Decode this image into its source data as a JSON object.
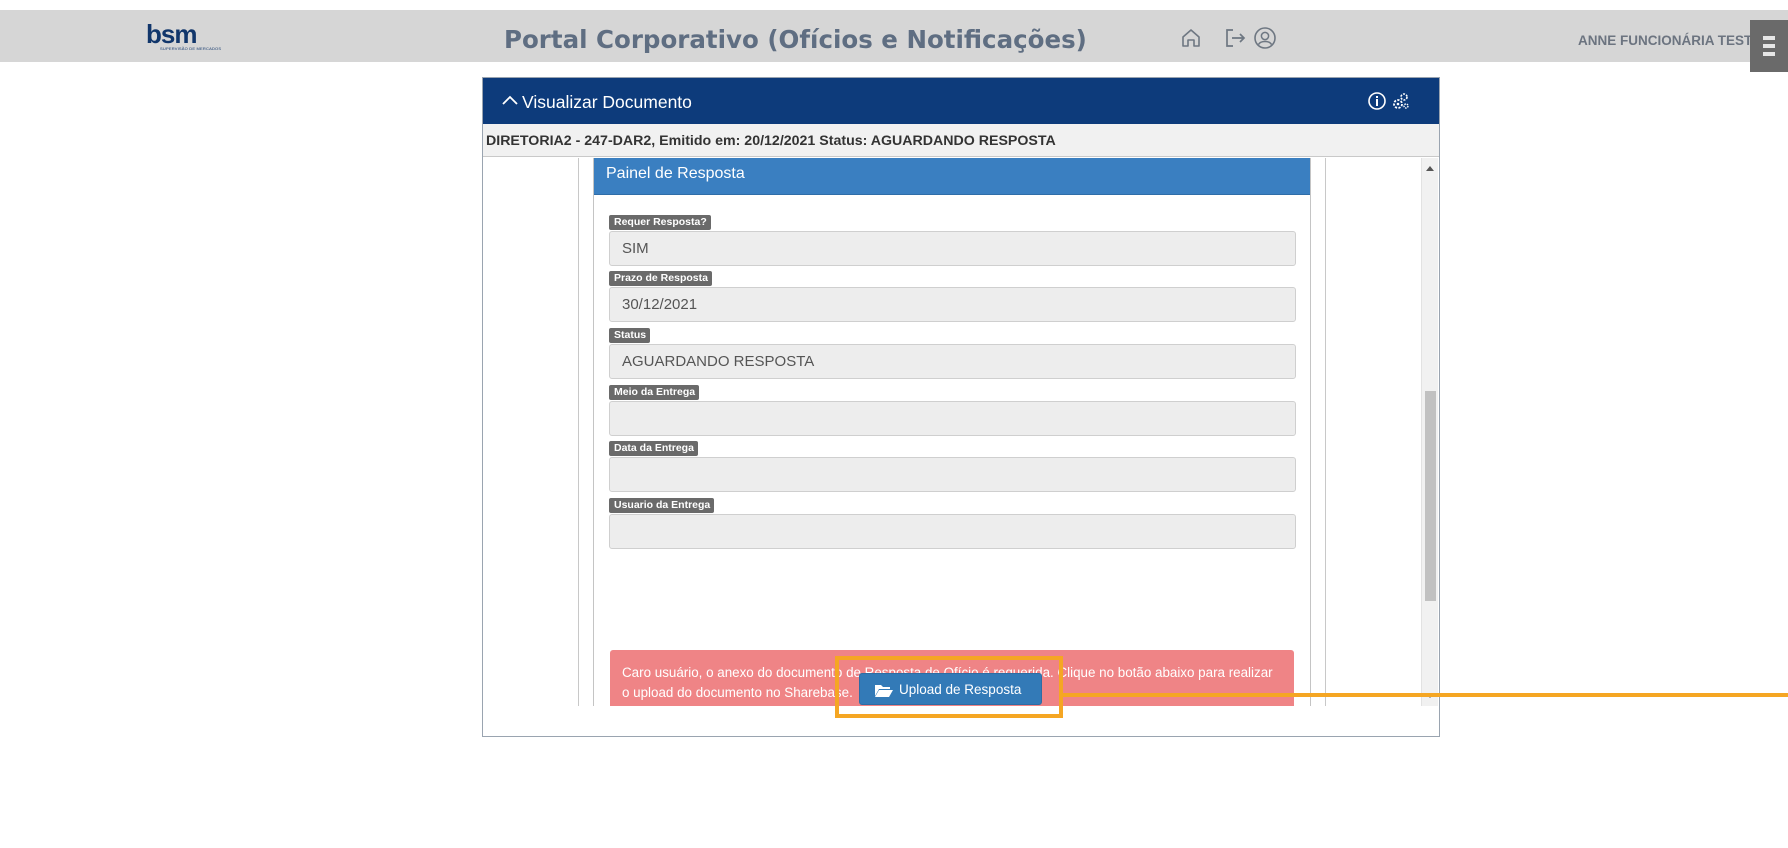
{
  "topbar": {
    "logo_text": "bsm",
    "logo_subtext": "SUPERVISÃO DE MERCADOS",
    "title": "Portal Corporativo (Ofícios e Notificações)",
    "user_name": "ANNE FUNCIONÁRIA TESTE",
    "icons": [
      "home-icon",
      "logout-icon",
      "user-icon",
      "menu-icon"
    ]
  },
  "panel": {
    "title": "Visualizar Documento",
    "header_icons": [
      "info-icon",
      "cogs-icon"
    ],
    "doc_line": "DIRETORIA2 - 247-DAR2, Emitido em: 20/12/2021 Status: AGUARDANDO RESPOSTA"
  },
  "resposta": {
    "title": "Painel de Resposta",
    "fields": [
      {
        "label": "Requer Resposta?",
        "value": "SIM"
      },
      {
        "label": "Prazo de Resposta",
        "value": "30/12/2021"
      },
      {
        "label": "Status",
        "value": "AGUARDANDO RESPOSTA"
      },
      {
        "label": "Meio da Entrega",
        "value": ""
      },
      {
        "label": "Data da Entrega",
        "value": ""
      },
      {
        "label": "Usuario da Entrega",
        "value": ""
      }
    ],
    "alert": "Caro usuário, o anexo do documento de Resposta de Ofício é requerida. Clique no botão abaixo para realizar o upload do documento no Sharebase.",
    "upload_label": "Upload de Resposta"
  },
  "colors": {
    "topbar_bg": "#d6d6d6",
    "panel_header": "#0d3b7b",
    "resposta_header": "#3a7fc1",
    "alert_bg": "#ef8486",
    "button_bg": "#337ab7",
    "highlight": "#f5a623"
  }
}
